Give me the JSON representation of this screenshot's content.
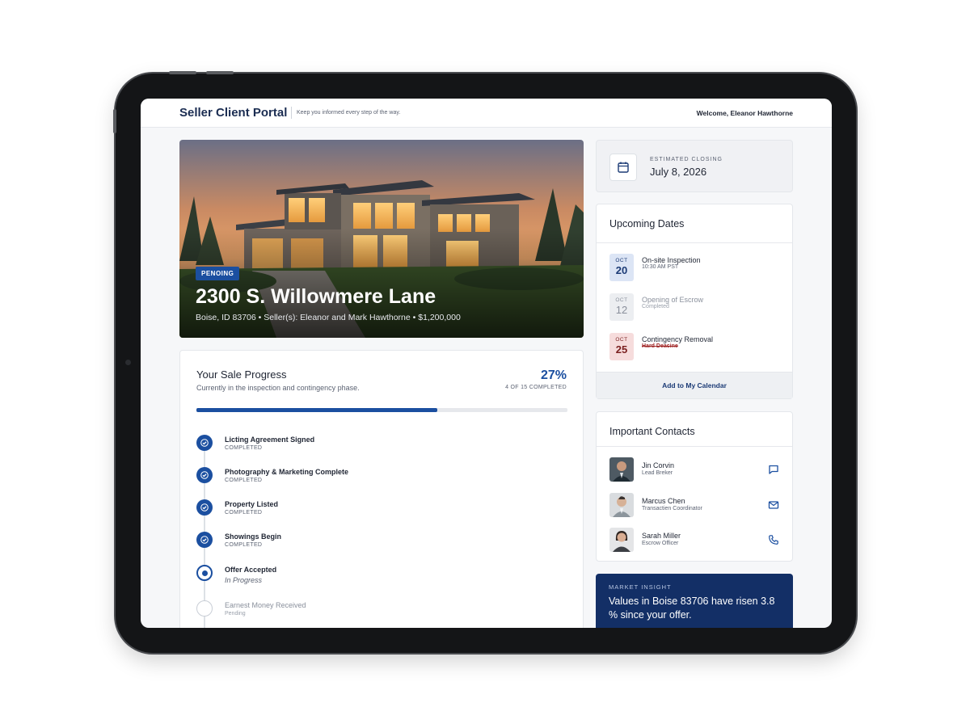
{
  "header": {
    "brand": "Seller Client Portal",
    "tagline": "Keep you informed every step of the way.",
    "welcome": "Welcome, Eleanor Hawthorne"
  },
  "hero": {
    "badge": "PENOING",
    "title": "2300 S. Willowmere Lane",
    "subtitle": "Boise, ID 83706 • Seller(s): Eleanor and Mark Hawthorne • $1,200,000"
  },
  "progress": {
    "title": "Your Sale Progress",
    "subtitle": "Currently in the inspection and contingency phase.",
    "percent_label": "27%",
    "count_label": "4 OF 15 COMPLETED",
    "bar_fill_fraction": 0.65,
    "steps": [
      {
        "label": "Licting Agreement Signed",
        "status": "COMPLETED",
        "state": "done"
      },
      {
        "label": "Photography & Marketing Complete",
        "status": "COMPLETED",
        "state": "done"
      },
      {
        "label": "Property Listed",
        "status": "COMPLETED",
        "state": "done"
      },
      {
        "label": "Showings Begin",
        "status": "COMPLETED",
        "state": "done"
      },
      {
        "label": "Offer Accepted",
        "status": "In Progress",
        "state": "current"
      },
      {
        "label": "Earnest Money Received",
        "status": "Pending",
        "state": "pending"
      }
    ]
  },
  "closing": {
    "label": "ESTIMATED CLOSING",
    "date": "July 8, 2026"
  },
  "upcoming": {
    "title": "Upcoming Dates",
    "items": [
      {
        "month": "OCT",
        "day": "20",
        "title": "On-site Inspection",
        "sub": "10:30 AM PST"
      },
      {
        "month": "OCT",
        "day": "12",
        "title": "Opening of Escrow",
        "sub": "Completed"
      },
      {
        "month": "OCT",
        "day": "25",
        "title": "Contingency Removal",
        "sub": "Hard Deacine"
      }
    ],
    "calendar_button": "Add to My Calendar"
  },
  "contacts": {
    "title": "Important Contacts",
    "items": [
      {
        "name": "Jin Corvin",
        "role": "Lead Breker",
        "action_icon": "chat-icon"
      },
      {
        "name": "Marcus Chen",
        "role": "Transactien Coordinator",
        "action_icon": "mail-icon"
      },
      {
        "name": "Sarah Miller",
        "role": "Escrow Officer",
        "action_icon": "phone-icon"
      }
    ]
  },
  "insight": {
    "label": "MARKET INSIGHT",
    "text": "Values in Boise 83706 have risen 3.8 % since your offer."
  },
  "colors": {
    "accent": "#1b4fa0",
    "navy": "#132f66",
    "alert": "#a12a2a"
  }
}
